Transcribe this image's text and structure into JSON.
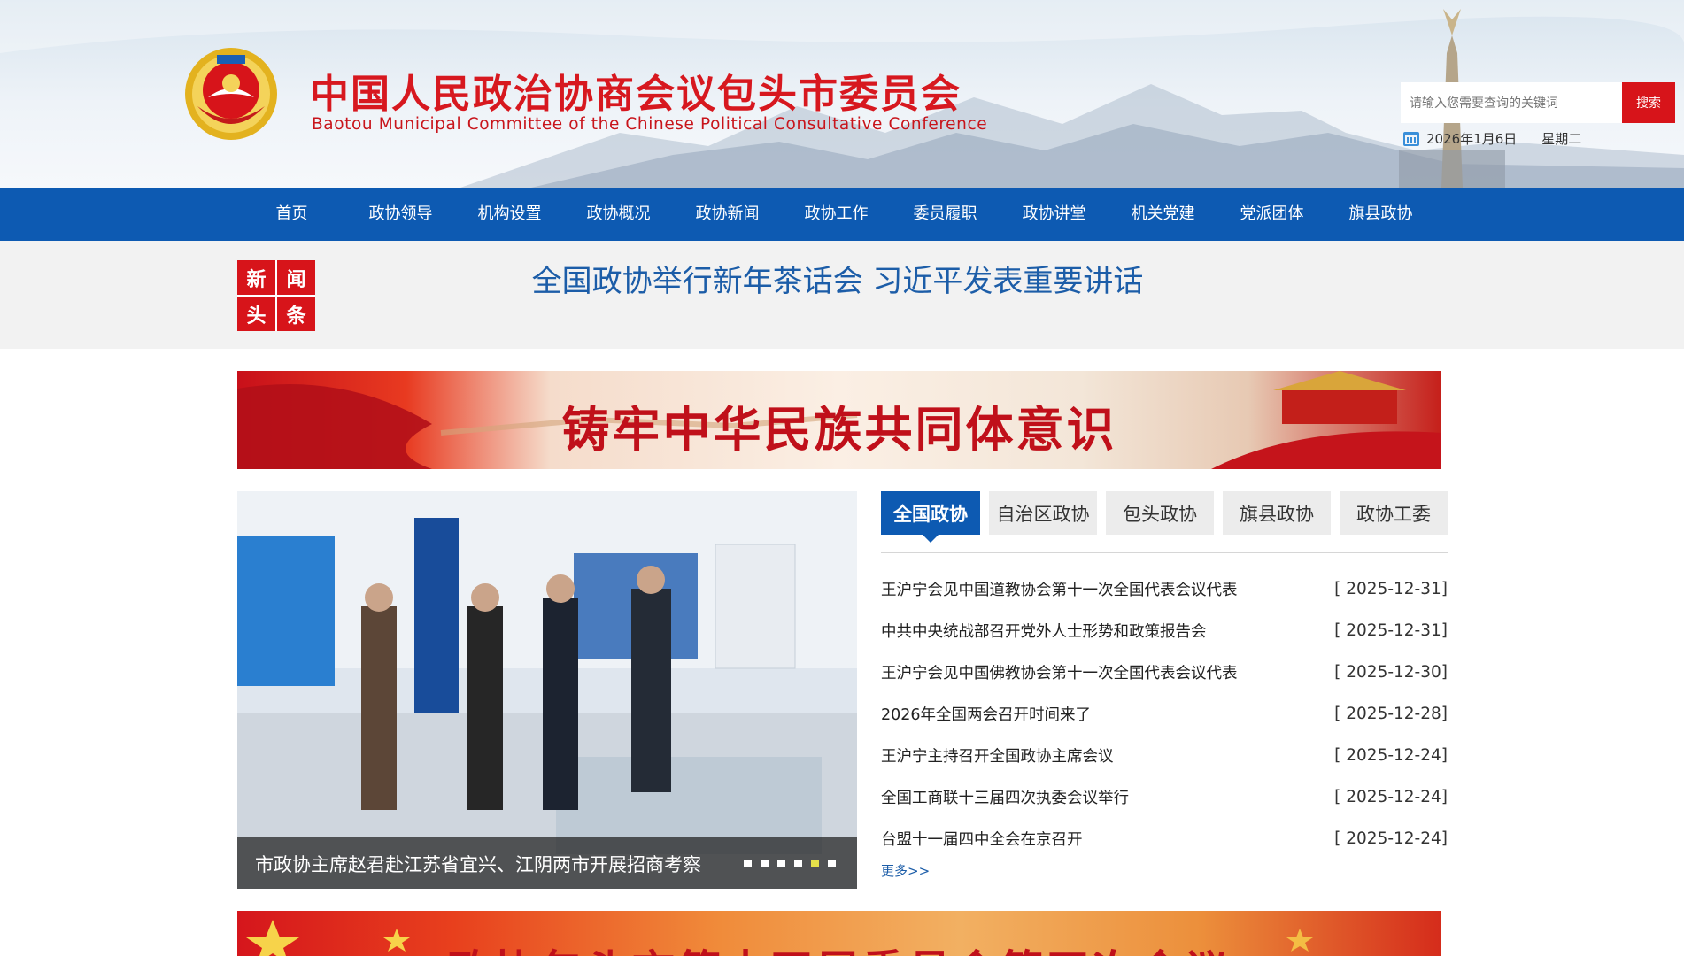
{
  "header": {
    "title": "中国人民政治协商会议包头市委员会",
    "subtitle": "Baotou Municipal Committee of the Chinese Political Consultative Conference",
    "search_placeholder": "请输入您需要查询的关键词",
    "search_button": "搜索",
    "date": "2026年1月6日",
    "weekday": "星期二"
  },
  "nav": {
    "items": [
      "首页",
      "政协领导",
      "机构设置",
      "政协概况",
      "政协新闻",
      "政协工作",
      "委员履职",
      "政协讲堂",
      "机关党建",
      "党派团体",
      "旗县政协"
    ]
  },
  "headline": {
    "tag": [
      "新",
      "闻",
      "头",
      "条"
    ],
    "text": "全国政协举行新年茶话会 习近平发表重要讲话"
  },
  "banner": {
    "text": "铸牢中华民族共同体意识"
  },
  "slideshow": {
    "caption": "市政协主席赵君赴江苏省宜兴、江阴两市开展招商考察",
    "dot_count": 6,
    "active_dot": 5
  },
  "tabs": {
    "items": [
      "全国政协",
      "自治区政协",
      "包头政协",
      "旗县政协",
      "政协工委"
    ],
    "active": 0
  },
  "news": [
    {
      "title": "王沪宁会见中国道教协会第十一次全国代表会议代表",
      "date": "[ 2025-12-31]"
    },
    {
      "title": "中共中央统战部召开党外人士形势和政策报告会",
      "date": "[ 2025-12-31]"
    },
    {
      "title": "王沪宁会见中国佛教协会第十一次全国代表会议代表",
      "date": "[ 2025-12-30]"
    },
    {
      "title": "2026年全国两会召开时间来了",
      "date": "[ 2025-12-28]"
    },
    {
      "title": "王沪宁主持召开全国政协主席会议",
      "date": "[ 2025-12-24]"
    },
    {
      "title": "全国工商联十三届四次执委会议举行",
      "date": "[ 2025-12-24]"
    },
    {
      "title": "台盟十一届四中全会在京召开",
      "date": "[ 2025-12-24]"
    }
  ],
  "more_link": "更多>>",
  "banner2": {
    "text": "政协包头市第十四届委员会第四次会议"
  },
  "colors": {
    "brand_red": "#d7141a",
    "nav_blue": "#0d5ab2",
    "headline_blue": "#1c5da8"
  }
}
